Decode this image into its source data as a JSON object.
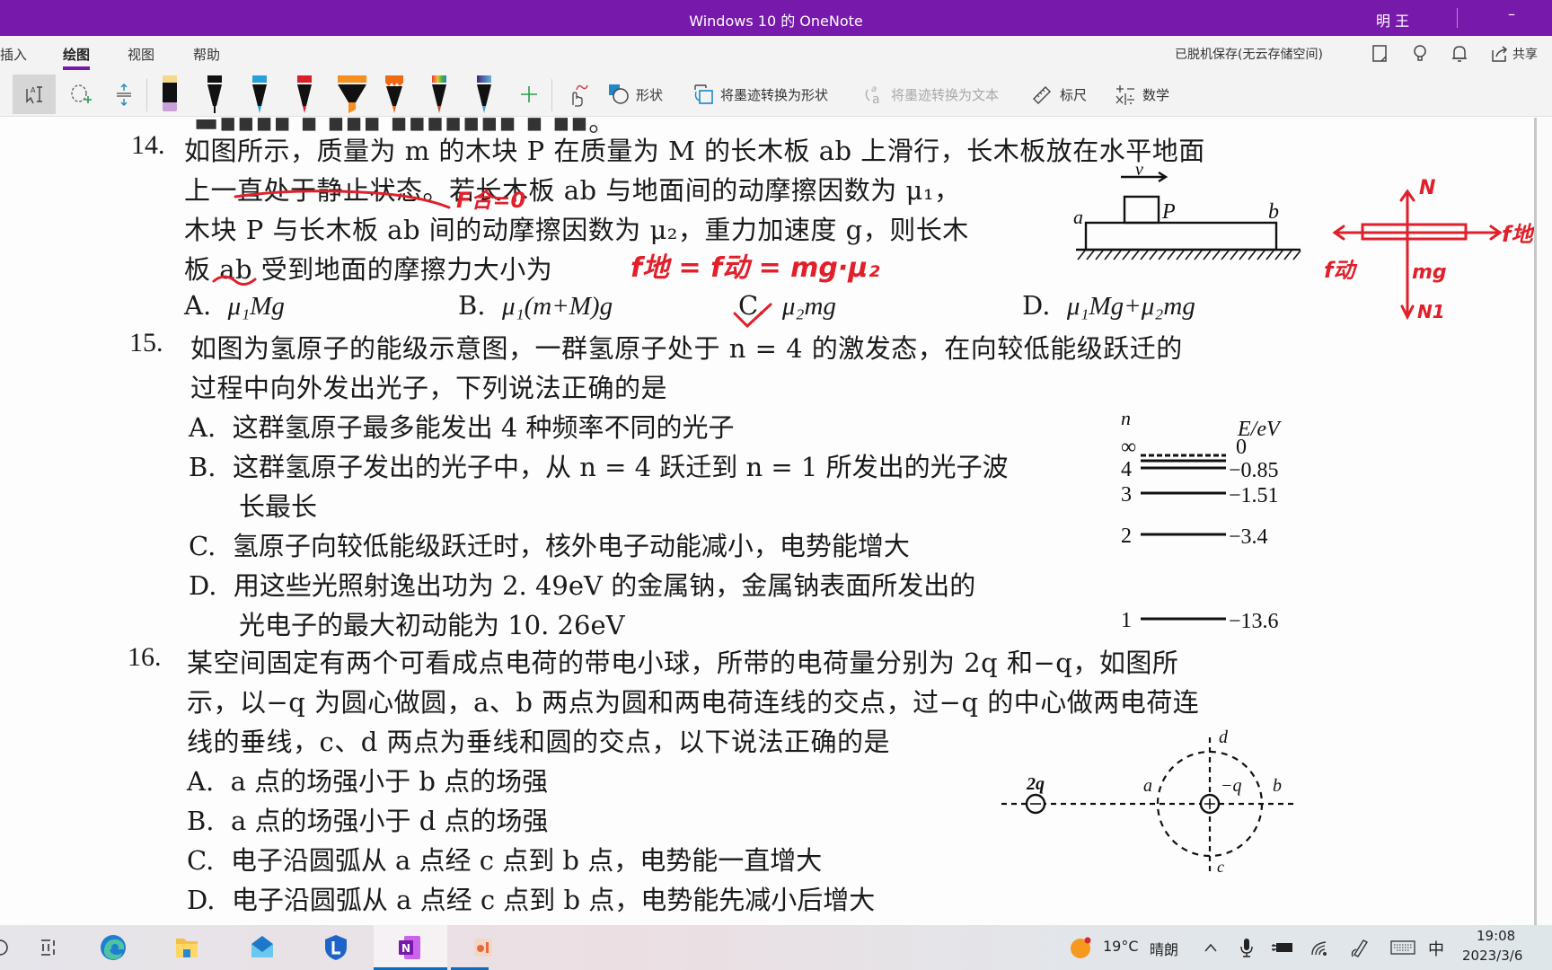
{
  "window": {
    "title": "Windows 10 的 OneNote",
    "user": "明 王",
    "minimize_glyph": "–"
  },
  "ribbon": {
    "tabs": [
      {
        "label": "插入",
        "active": false
      },
      {
        "label": "绘图",
        "active": true
      },
      {
        "label": "视图",
        "active": false
      },
      {
        "label": "帮助",
        "active": false
      }
    ],
    "save_status": "已脱机保存(无云存储空间)",
    "share_label": "共享",
    "tools": {
      "select_tool": "lasso-text-select",
      "lasso": "lasso-select",
      "add_space": "add-space",
      "pens": [
        {
          "name": "highlighter-yellow",
          "cap": "#f4d98a",
          "tip": "#c9a0d8"
        },
        {
          "name": "pen-black",
          "cap": "#111111",
          "tip": "#111111"
        },
        {
          "name": "pen-blue",
          "cap": "#2aa0d8",
          "tip": "#2aa0d8"
        },
        {
          "name": "pen-red",
          "cap": "#d81f2a",
          "tip": "#d81f2a"
        },
        {
          "name": "highlighter-orange",
          "cap": "#f5901e",
          "tip": "#f5901e"
        },
        {
          "name": "pencil-orange",
          "cap": "#ef6a12",
          "tip": "#ef6a12"
        },
        {
          "name": "pen-rainbow",
          "cap": "#e8a030",
          "tip": "#d0502a"
        },
        {
          "name": "pen-galaxy",
          "cap": "#5a4aa8",
          "tip": "#4aa0c8"
        }
      ],
      "add_pen": "+",
      "shapes_label": "形状",
      "ink_to_shape_label": "将墨迹转换为形状",
      "ink_to_text_label": "将墨迹转换为文本",
      "ruler_label": "标尺",
      "math_label": "数学"
    }
  },
  "page": {
    "q14": {
      "number": "14.",
      "lines": [
        "如图所示，质量为 m 的木块 P 在质量为 M 的长木板 ab 上滑行，长木板放在水平地面",
        "上一直处于静止状态。若长木板 ab 与地面间的动摩擦因数为 μ₁，",
        "木块 P 与长木板 ab 间的动摩擦因数为 μ₂，重力加速度 g，则长木",
        "板 ab 受到地面的摩擦力大小为"
      ],
      "options": [
        {
          "key": "A.",
          "text": "μ₁Mg"
        },
        {
          "key": "B.",
          "text": "μ₁(m+M)g"
        },
        {
          "key": "C.",
          "text": "μ₂mg"
        },
        {
          "key": "D.",
          "text": "μ₁Mg+μ₂mg"
        }
      ],
      "figure": {
        "label_a": "a",
        "label_b": "b",
        "label_p": "P",
        "label_v": "v"
      }
    },
    "q15": {
      "number": "15.",
      "lines": [
        "如图为氢原子的能级示意图，一群氢原子处于 n = 4 的激发态，在向较低能级跃迁的",
        "过程中向外发出光子，下列说法正确的是"
      ],
      "options": [
        {
          "key": "A.",
          "lines": [
            "这群氢原子最多能发出 4 种频率不同的光子"
          ]
        },
        {
          "key": "B.",
          "lines": [
            "这群氢原子发出的光子中，从 n = 4 跃迁到 n = 1 所发出的光子波",
            "长最长"
          ]
        },
        {
          "key": "C.",
          "lines": [
            "氢原子向较低能级跃迁时，核外电子动能减小，电势能增大"
          ]
        },
        {
          "key": "D.",
          "lines": [
            "用这些光照射逸出功为 2. 49eV 的金属钠，金属钠表面所发出的",
            "光电子的最大初动能为 10. 26eV"
          ]
        }
      ],
      "energy_diagram": {
        "n_label": "n",
        "e_label": "E/eV",
        "levels": [
          {
            "n": "∞",
            "energy": "0"
          },
          {
            "n": "4",
            "energy": "-0.85"
          },
          {
            "n": "3",
            "energy": "-1.51"
          },
          {
            "n": "2",
            "energy": "-3.4"
          },
          {
            "n": "1",
            "energy": "-13.6"
          }
        ]
      }
    },
    "q16": {
      "number": "16.",
      "lines": [
        "某空间固定有两个可看成点电荷的带电小球，所带的电荷量分别为 2q 和−q，如图所",
        "示，以−q 为圆心做圆，a、b 两点为圆和两电荷连线的交点，过−q 的中心做两电荷连",
        "线的垂线，c、d 两点为垂线和圆的交点，以下说法正确的是"
      ],
      "options": [
        {
          "key": "A.",
          "text": "a 点的场强小于 b 点的场强"
        },
        {
          "key": "B.",
          "text": "a 点的场强小于 d 点的场强"
        },
        {
          "key": "C.",
          "text": "电子沿圆弧从 a 点经 c 点到 b 点，电势能一直增大"
        },
        {
          "key": "D.",
          "text": "电子沿圆弧从 a 点经 c 点到 b 点，电势能先减小后增大"
        }
      ],
      "figure": {
        "charge_left": "2q",
        "charge_right": "−q",
        "a": "a",
        "b": "b",
        "c": "c",
        "d": "d"
      }
    },
    "ink_annotations": {
      "f_zero": "F合=0",
      "equation": "f地 = f动 = mg·μ₂",
      "fbd_N": "N",
      "fbd_N1": "N1",
      "fbd_mg": "mg",
      "fbd_f_left": "f动",
      "fbd_f_right": "f地",
      "ink_color": "#e0202a"
    }
  },
  "taskbar": {
    "apps": [
      "task-view",
      "edge",
      "file-explorer",
      "mail",
      "lenovo-vantage",
      "onenote",
      "powerpoint-like"
    ],
    "weather_temp": "19°C",
    "weather_desc": "晴朗",
    "ime": "中",
    "time": "19:08",
    "date": "2023/3/6"
  }
}
